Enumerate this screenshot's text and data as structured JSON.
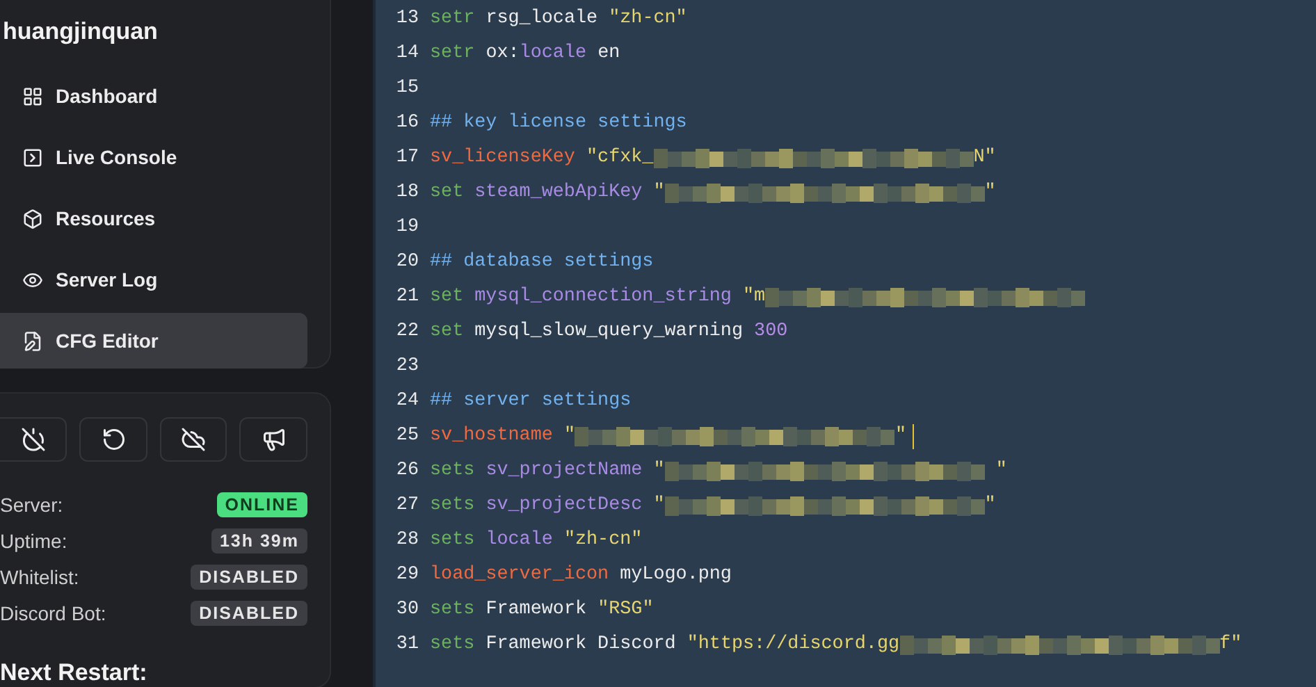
{
  "sidebar": {
    "username": "huangjinquan",
    "nav": [
      {
        "label": "Dashboard",
        "selected": false
      },
      {
        "label": "Live Console",
        "selected": false
      },
      {
        "label": "Resources",
        "selected": false
      },
      {
        "label": "Server Log",
        "selected": false
      },
      {
        "label": "CFG Editor",
        "selected": true
      }
    ],
    "status": [
      {
        "label": "Server:",
        "value": "ONLINE",
        "kind": "success"
      },
      {
        "label": "Uptime:",
        "value": "13h 39m",
        "kind": "neutral"
      },
      {
        "label": "Whitelist:",
        "value": "DISABLED",
        "kind": "neutral"
      },
      {
        "label": "Discord Bot:",
        "value": "DISABLED",
        "kind": "neutral"
      }
    ],
    "next_restart": "Next Restart:"
  },
  "editor": {
    "lines": [
      {
        "number": "13",
        "tokens": [
          {
            "kind": "keyword",
            "text": "setr"
          },
          {
            "kind": "plain",
            "text": " rsg_locale "
          },
          {
            "kind": "string",
            "text": "\"zh-cn\""
          }
        ]
      },
      {
        "number": "14",
        "tokens": [
          {
            "kind": "keyword",
            "text": "setr"
          },
          {
            "kind": "plain",
            "text": " ox:"
          },
          {
            "kind": "property",
            "text": "locale"
          },
          {
            "kind": "plain",
            "text": " en"
          }
        ]
      },
      {
        "number": "15"
      },
      {
        "number": "16",
        "tokens": [
          {
            "kind": "comment",
            "text": "## key license settings"
          }
        ]
      },
      {
        "number": "17",
        "tokens": [
          {
            "kind": "special",
            "text": "sv_licenseKey"
          },
          {
            "kind": "string",
            "text": " \"cfxk_"
          },
          {
            "kind": "redacted"
          },
          {
            "kind": "string",
            "text": "N\""
          }
        ]
      },
      {
        "number": "18",
        "tokens": [
          {
            "kind": "keyword",
            "text": "set"
          },
          {
            "kind": "property",
            "text": " steam_webApiKey"
          },
          {
            "kind": "string",
            "text": " \""
          },
          {
            "kind": "redacted"
          },
          {
            "kind": "string",
            "text": "\""
          }
        ]
      },
      {
        "number": "19"
      },
      {
        "number": "20",
        "tokens": [
          {
            "kind": "comment",
            "text": "## database settings"
          }
        ]
      },
      {
        "number": "21",
        "tokens": [
          {
            "kind": "keyword",
            "text": "set"
          },
          {
            "kind": "property",
            "text": " mysql_connection_string"
          },
          {
            "kind": "string",
            "text": " \"m"
          },
          {
            "kind": "redacted"
          }
        ]
      },
      {
        "number": "22",
        "tokens": [
          {
            "kind": "keyword",
            "text": "set"
          },
          {
            "kind": "plain",
            "text": " mysql_slow_query_warning "
          },
          {
            "kind": "number",
            "text": "300"
          }
        ]
      },
      {
        "number": "23"
      },
      {
        "number": "24",
        "tokens": [
          {
            "kind": "comment",
            "text": "## server settings"
          }
        ]
      },
      {
        "number": "25",
        "tokens": [
          {
            "kind": "special",
            "text": "sv_hostname"
          },
          {
            "kind": "string",
            "text": " \""
          },
          {
            "kind": "redacted"
          },
          {
            "kind": "string",
            "text": "\""
          },
          {
            "kind": "caret"
          }
        ]
      },
      {
        "number": "26",
        "tokens": [
          {
            "kind": "keyword",
            "text": "sets"
          },
          {
            "kind": "property",
            "text": " sv_projectName"
          },
          {
            "kind": "string",
            "text": " \""
          },
          {
            "kind": "redacted"
          },
          {
            "kind": "string",
            "text": " \""
          }
        ]
      },
      {
        "number": "27",
        "tokens": [
          {
            "kind": "keyword",
            "text": "sets"
          },
          {
            "kind": "property",
            "text": " sv_projectDesc"
          },
          {
            "kind": "string",
            "text": " \""
          },
          {
            "kind": "redacted"
          },
          {
            "kind": "string",
            "text": "\""
          }
        ]
      },
      {
        "number": "28",
        "tokens": [
          {
            "kind": "keyword",
            "text": "sets"
          },
          {
            "kind": "property",
            "text": " locale"
          },
          {
            "kind": "string",
            "text": " \"zh-cn\""
          }
        ]
      },
      {
        "number": "29",
        "tokens": [
          {
            "kind": "special",
            "text": "load_server_icon"
          },
          {
            "kind": "plain",
            "text": " myLogo.png"
          }
        ]
      },
      {
        "number": "30",
        "tokens": [
          {
            "kind": "keyword",
            "text": "sets"
          },
          {
            "kind": "plain",
            "text": " Framework "
          },
          {
            "kind": "string",
            "text": "\"RSG\""
          }
        ]
      },
      {
        "number": "31",
        "tokens": [
          {
            "kind": "keyword",
            "text": "sets"
          },
          {
            "kind": "plain",
            "text": " Framework Discord "
          },
          {
            "kind": "string",
            "text": "\"https://discord.gg"
          },
          {
            "kind": "redacted"
          },
          {
            "kind": "string",
            "text": "f\""
          }
        ]
      }
    ]
  }
}
